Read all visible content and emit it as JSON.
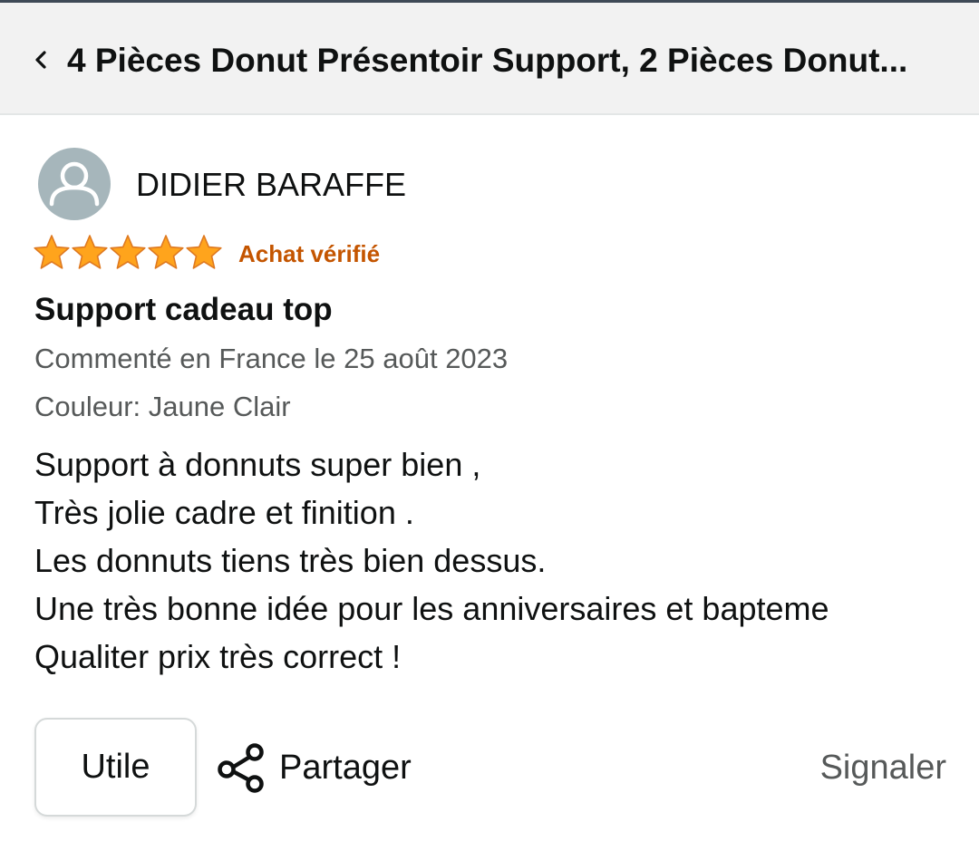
{
  "header": {
    "back_icon": "chevron-left-icon",
    "title": "4 Pièces Donut Présentoir Support, 2 Pièces Donut..."
  },
  "review": {
    "avatar_icon": "user-avatar-icon",
    "reviewer_name": "DIDIER BARAFFE",
    "rating": 5,
    "rating_max": 5,
    "star_color": "#ffa41c",
    "verified_label": "Achat vérifié",
    "verified_color": "#c45500",
    "title": "Support cadeau top",
    "date_line": "Commenté en France le 25 août 2023",
    "variant_line": "Couleur: Jaune Clair",
    "body_lines": [
      "Support à donnuts super bien ,",
      "Très jolie cadre et finition .",
      "Les donnuts tiens très bien dessus.",
      "Une très bonne idée pour les anniversaires et bapteme",
      "Qualiter prix très correct !"
    ]
  },
  "actions": {
    "helpful_label": "Utile",
    "share_icon": "share-icon",
    "share_label": "Partager",
    "report_label": "Signaler"
  }
}
